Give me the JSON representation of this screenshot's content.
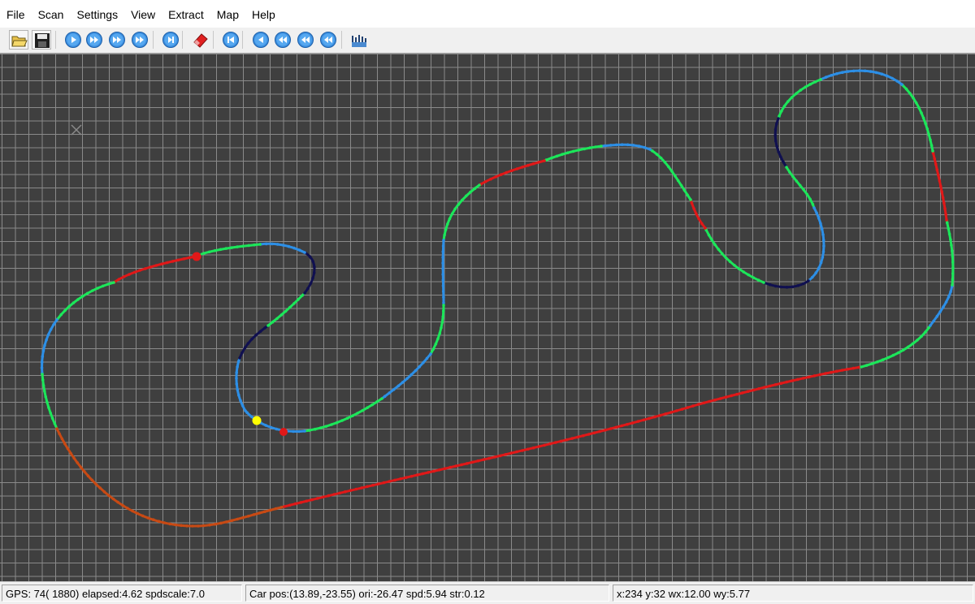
{
  "menu": [
    "File",
    "Scan",
    "Settings",
    "View",
    "Extract",
    "Map",
    "Help"
  ],
  "toolbar": {
    "buttons": [
      {
        "name": "open-folder-icon"
      },
      {
        "name": "save-icon"
      },
      {
        "name": "play-icon"
      },
      {
        "name": "fast-forward-icon"
      },
      {
        "name": "fast-forward-2-icon"
      },
      {
        "name": "fast-forward-3-icon"
      },
      {
        "name": "step-forward-icon"
      },
      {
        "name": "eraser-icon"
      },
      {
        "name": "skip-to-start-icon"
      },
      {
        "name": "rewind-icon"
      },
      {
        "name": "rewind-2-icon"
      },
      {
        "name": "rewind-3-icon"
      },
      {
        "name": "rewind-4-icon"
      },
      {
        "name": "map-grid-icon"
      }
    ]
  },
  "canvas": {
    "background": "#3f3f3f",
    "grid_color": "#8a8a8a",
    "track_colors": {
      "red": "#e01818",
      "orange": "#c84a14",
      "green": "#1ce65a",
      "blue": "#2d8fe6",
      "navy": "#101050",
      "cyan": "#22d8e0"
    },
    "markers": [
      {
        "name": "car-position-marker",
        "color": "#ffff00"
      },
      {
        "name": "waypoint-marker-1",
        "color": "#e01818"
      },
      {
        "name": "waypoint-marker-2",
        "color": "#e01818"
      }
    ],
    "origin_marker": {
      "name": "origin-cross-icon",
      "color": "#8a8a8a"
    }
  },
  "status": {
    "gps": "GPS:  74( 1880) elapsed:4.62 spdscale:7.0",
    "car": "Car pos:(13.89,-23.55) ori:-26.47 spd:5.94 str:0.12",
    "cursor": "x:234 y:32 wx:12.00 wy:5.77"
  }
}
